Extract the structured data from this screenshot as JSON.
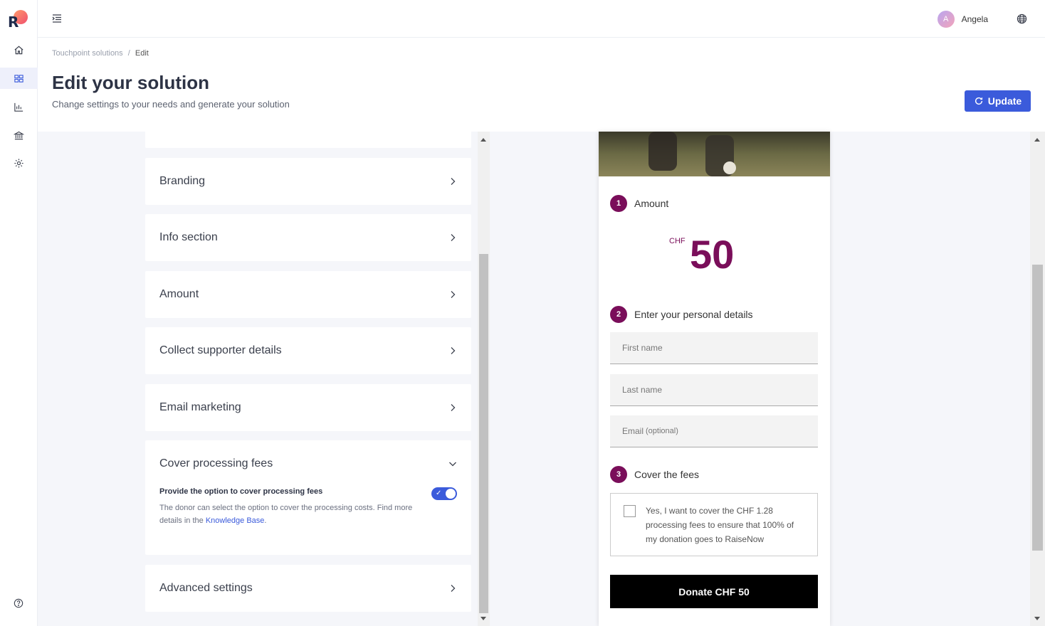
{
  "app": {
    "logo_letter": "R"
  },
  "sidebar": {
    "items": [
      {
        "name": "home-icon"
      },
      {
        "name": "grid-icon"
      },
      {
        "name": "chart-icon"
      },
      {
        "name": "bank-icon"
      },
      {
        "name": "gear-icon"
      }
    ],
    "help": "help-icon"
  },
  "topbar": {
    "user_initial": "A",
    "user_name": "Angela"
  },
  "header": {
    "breadcrumb_root": "Touchpoint solutions",
    "breadcrumb_sep": "/",
    "breadcrumb_current": "Edit",
    "title": "Edit your solution",
    "subtitle": "Change settings to your needs and generate your solution",
    "update_label": "Update"
  },
  "settings": {
    "sections": [
      {
        "label": "Branding"
      },
      {
        "label": "Info section"
      },
      {
        "label": "Amount"
      },
      {
        "label": "Collect supporter details"
      },
      {
        "label": "Email marketing"
      },
      {
        "label": "Cover processing fees"
      },
      {
        "label": "Advanced settings"
      }
    ],
    "cover_fees": {
      "option_title": "Provide the option to cover processing fees",
      "desc_text": "The donor can select the option to cover the processing costs. Find more details in the ",
      "link_text": "Knowledge Base",
      "desc_end": ".",
      "enabled": true
    }
  },
  "preview": {
    "accent_color": "#7a0e5a",
    "step1": {
      "num": "1",
      "label": "Amount"
    },
    "currency": "CHF",
    "amount": "50",
    "step2": {
      "num": "2",
      "label": "Enter your personal details"
    },
    "fields": {
      "first_name": "First name",
      "last_name": "Last name",
      "email": "Email",
      "email_optional": "(optional)"
    },
    "step3": {
      "num": "3",
      "label": "Cover the fees"
    },
    "fees_text": "Yes, I want to cover the CHF 1.28 processing fees to ensure that 100% of my donation goes to RaiseNow",
    "donate_label": "Donate CHF 50"
  }
}
